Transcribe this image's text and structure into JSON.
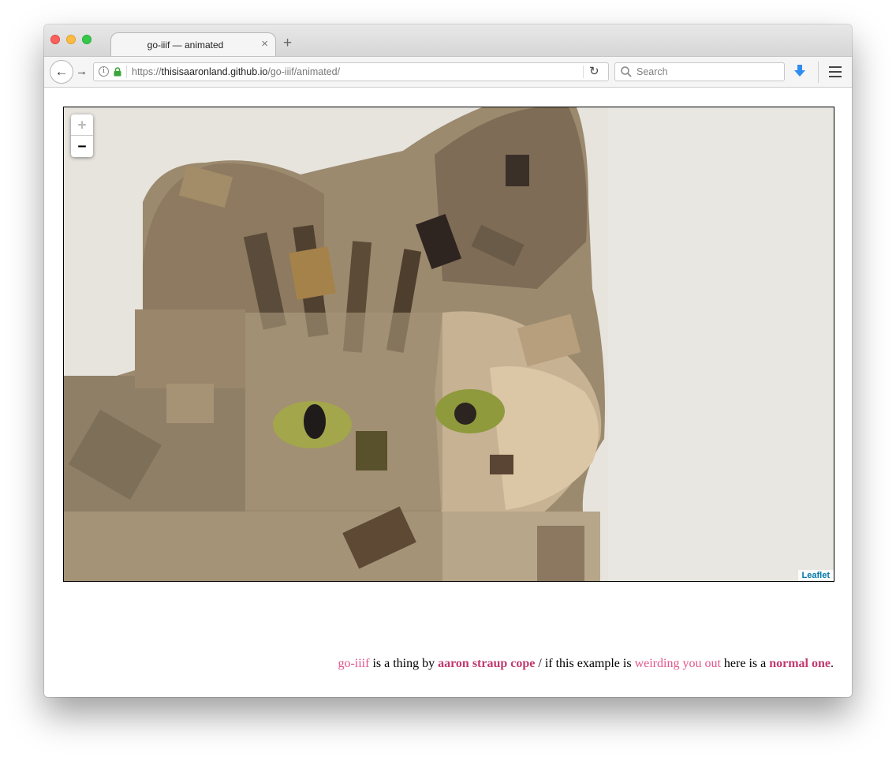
{
  "browser": {
    "tab": {
      "title": "go-iiif — animated",
      "close": "×"
    },
    "new_tab": "+",
    "back": "←",
    "forward": "→",
    "url": {
      "prefix": "https://",
      "host": "thisisaaronland.github.io",
      "path": "/go-iiif/animated/"
    },
    "reload": "↻",
    "search": {
      "placeholder": "Search"
    },
    "info": "i"
  },
  "map": {
    "zoom_in": "+",
    "zoom_out": "−",
    "attribution": "Leaflet",
    "image_subject": "cat"
  },
  "footer": {
    "link1": "go-iiif",
    "text1": " is a thing by ",
    "author": "aaron straup cope",
    "text2": " / if this example is ",
    "link2": "weirding you out",
    "text3": " here is a ",
    "link3": "normal one",
    "text4": "."
  }
}
